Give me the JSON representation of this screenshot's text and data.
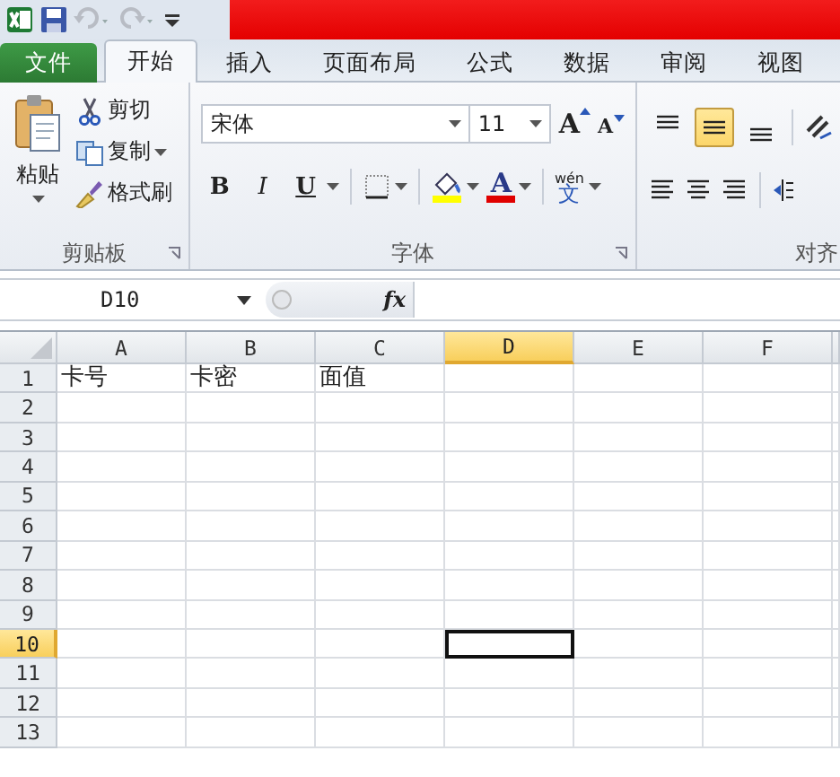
{
  "tabs": [
    {
      "label": "文件",
      "kind": "file",
      "selected": false
    },
    {
      "label": "开始",
      "kind": "tab",
      "selected": true
    },
    {
      "label": "插入",
      "kind": "tab",
      "selected": false
    },
    {
      "label": "页面布局",
      "kind": "tab",
      "selected": false
    },
    {
      "label": "公式",
      "kind": "tab",
      "selected": false
    },
    {
      "label": "数据",
      "kind": "tab",
      "selected": false
    },
    {
      "label": "审阅",
      "kind": "tab",
      "selected": false
    },
    {
      "label": "视图",
      "kind": "tab",
      "selected": false
    }
  ],
  "clipboard": {
    "label": "剪贴板",
    "paste": "粘贴",
    "cut": "剪切",
    "copy": "复制",
    "format_painter": "格式刷"
  },
  "font": {
    "label": "字体",
    "font_name": "宋体",
    "font_size": "11",
    "grow": "A",
    "shrink": "A",
    "styles": [
      {
        "kind": "bold",
        "label": "B"
      },
      {
        "kind": "italic",
        "label": "I"
      },
      {
        "kind": "underline",
        "label": "U"
      }
    ],
    "font_color": "A",
    "phonetic_top": "wén",
    "phonetic_bottom": "文"
  },
  "alignment": {
    "label": "对齐",
    "vertical": [
      {
        "kind": "top",
        "selected": false
      },
      {
        "kind": "middle",
        "selected": true
      },
      {
        "kind": "bottom",
        "selected": false
      }
    ]
  },
  "formula_bar": {
    "name_box": "D10",
    "function_label": "fx"
  },
  "sheet": {
    "columns": [
      {
        "label": "A",
        "selected": false
      },
      {
        "label": "B",
        "selected": false
      },
      {
        "label": "C",
        "selected": false
      },
      {
        "label": "D",
        "selected": true
      },
      {
        "label": "E",
        "selected": false
      },
      {
        "label": "F",
        "selected": false
      }
    ],
    "rows": [
      {
        "label": "1",
        "selected": false,
        "cells": [
          "卡号",
          "卡密",
          "面值"
        ]
      },
      {
        "label": "2",
        "selected": false
      },
      {
        "label": "3",
        "selected": false
      },
      {
        "label": "4",
        "selected": false
      },
      {
        "label": "5",
        "selected": false
      },
      {
        "label": "6",
        "selected": false
      },
      {
        "label": "7",
        "selected": false
      },
      {
        "label": "8",
        "selected": false
      },
      {
        "label": "9",
        "selected": false
      },
      {
        "label": "10",
        "selected": true
      },
      {
        "label": "11",
        "selected": false
      },
      {
        "label": "12",
        "selected": false
      },
      {
        "label": "13",
        "selected": false
      }
    ]
  }
}
